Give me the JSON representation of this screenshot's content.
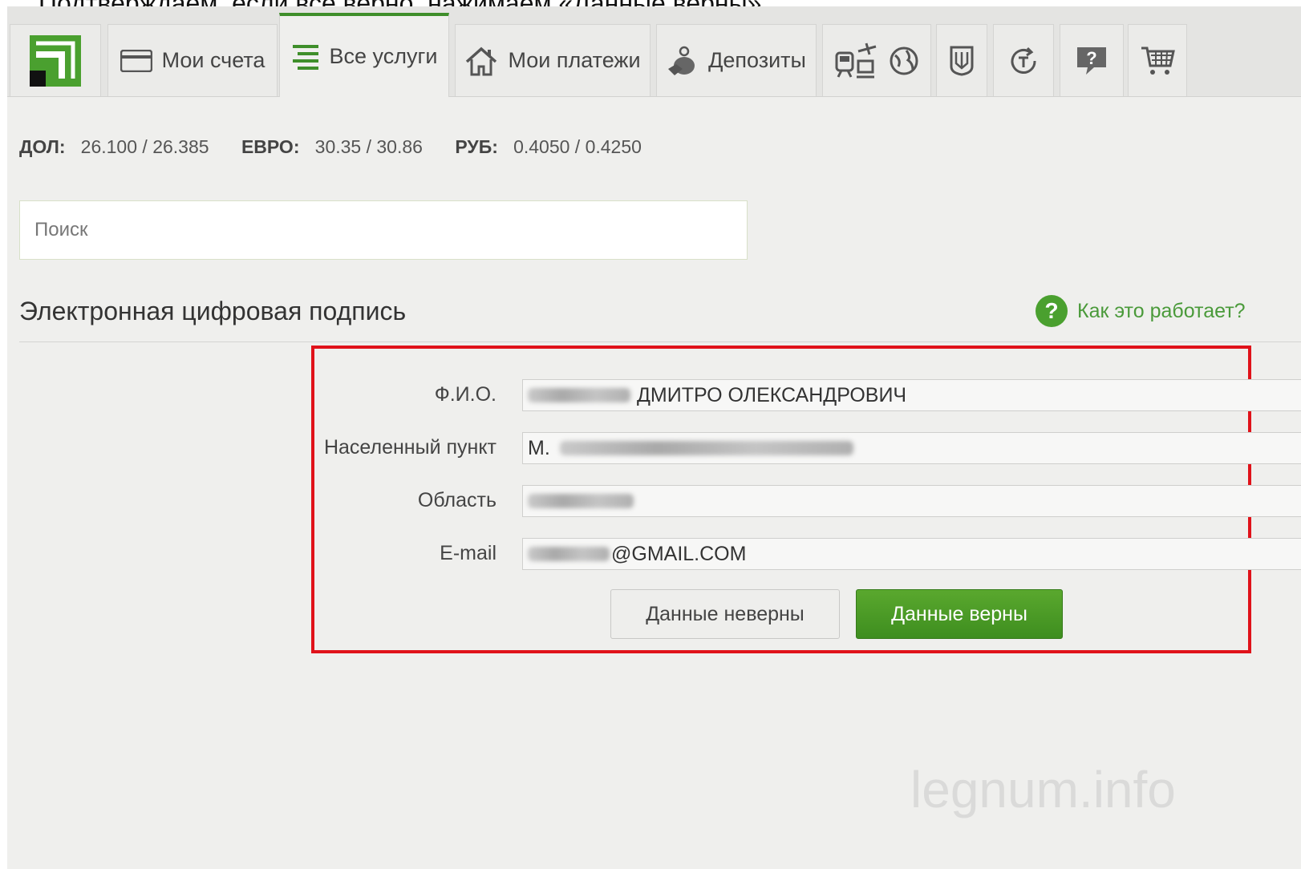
{
  "caption": "Подтверждаем, если все верно, нажимаем «Данные верны»",
  "nav": {
    "tabs": [
      {
        "label": "Мои счета",
        "icon": "card-icon"
      },
      {
        "label": "Все услуги",
        "icon": "list-icon"
      },
      {
        "label": "Мои платежи",
        "icon": "house-icon"
      },
      {
        "label": "Депозиты",
        "icon": "money-bag-icon"
      }
    ],
    "icon_tabs": [
      "train-plane-icon",
      "globe-icon",
      "ukraine-emblem-icon",
      "currency-exchange-icon",
      "help-chat-icon",
      "cart-icon"
    ]
  },
  "rates": {
    "usd_label": "ДОЛ:",
    "usd_value": "26.100 / 26.385",
    "eur_label": "ЕВРО:",
    "eur_value": "30.35 / 30.86",
    "rub_label": "РУБ:",
    "rub_value": "0.4050 / 0.4250"
  },
  "search": {
    "placeholder": "Поиск"
  },
  "section": {
    "title": "Электронная цифровая подпись",
    "help_link": "Как это работает?",
    "help_icon_text": "?"
  },
  "form": {
    "name_label": "Ф.И.О.",
    "name_value": "ДМИТРО ОЛЕКСАНДРОВИЧ",
    "city_label": "Населенный пункт",
    "city_value": "М.",
    "region_label": "Область",
    "region_value": "",
    "email_label": "E-mail",
    "email_value": "@GMAIL.COM",
    "wrong_button": "Данные неверны",
    "ok_button": "Данные верны"
  },
  "watermark": "legnum.info",
  "colors": {
    "accent": "#3e8e2a",
    "highlight": "#e0121a",
    "logo_green": "#4aa02f"
  }
}
